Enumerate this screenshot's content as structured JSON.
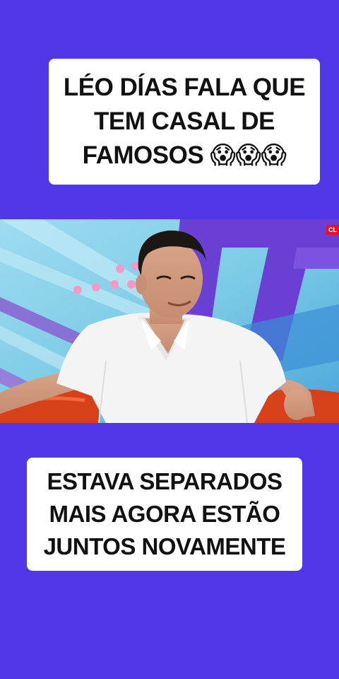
{
  "captions": {
    "top": "LÉO DÍAS FALA QUE\nTEM CASAL DE\nFAMOSOS 😱😱😱",
    "bottom": "ESTAVA SEPARADOS\nMAIS AGORA ESTÃO\nJUNTOS NOVAMENTE"
  },
  "video": {
    "badge": "CL"
  },
  "colors": {
    "background": "#5038e8",
    "caption_bg": "#ffffff",
    "caption_text": "#111111"
  }
}
